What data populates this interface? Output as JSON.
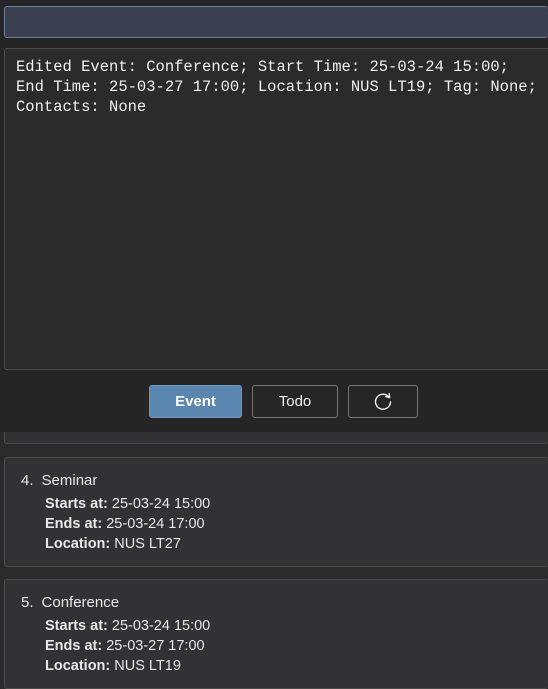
{
  "command": {
    "value": ""
  },
  "result": {
    "text": "Edited Event: Conference; Start Time: 25-03-24 15:00; End Time: 25-03-27 17:00; Location: NUS LT19; Tag: None; Contacts: None"
  },
  "buttons": {
    "event_label": "Event",
    "todo_label": "Todo",
    "refresh_icon": "refresh-icon"
  },
  "events": [
    {
      "index": "4.",
      "name": "Seminar",
      "starts_label": "Starts at:",
      "starts": "25-03-24 15:00",
      "ends_label": "Ends at:",
      "ends": "25-03-24 17:00",
      "location_label": "Location:",
      "location": "NUS LT27"
    },
    {
      "index": "5.",
      "name": "Conference",
      "starts_label": "Starts at:",
      "starts": "25-03-24 15:00",
      "ends_label": "Ends at:",
      "ends": "25-03-27 17:00",
      "location_label": "Location:",
      "location": "NUS LT19"
    }
  ],
  "colors": {
    "background": "#252526",
    "accent": "#5b86b0",
    "card": "#323234"
  }
}
